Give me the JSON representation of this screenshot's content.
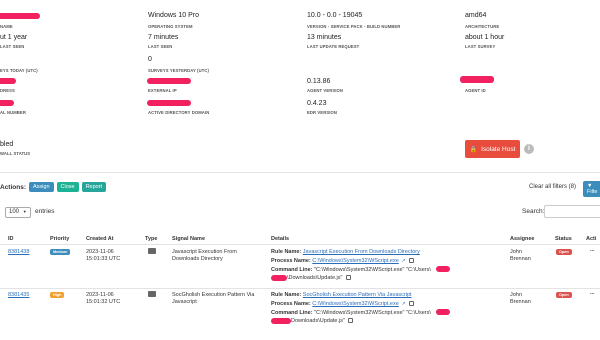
{
  "summary": {
    "row1": [
      {
        "label": "NAME",
        "value": ""
      },
      {
        "label": "OPERATING SYSTEM",
        "value": "Windows 10 Pro"
      },
      {
        "label": "VERSION - SERVICE PACK - BUILD NUMBER",
        "value": "10.0 - 0.0 - 19045"
      },
      {
        "label": "ARCHITECTURE",
        "value": "amd64"
      }
    ],
    "row2": [
      {
        "label": "LAST SEEN",
        "value": "ut 1 year"
      },
      {
        "label": "LAST SEEN",
        "value": "7 minutes"
      },
      {
        "label": "LAST UPDATE REQUEST",
        "value": "13 minutes"
      },
      {
        "label": "LAST SURVEY",
        "value": "about 1 hour"
      }
    ],
    "row3": [
      {
        "label": "EYS TODAY (UTC)",
        "value": ""
      },
      {
        "label": "SURVEYS YESTERDAY (UTC)",
        "value": "0"
      }
    ],
    "row4": [
      {
        "label": "DRESS",
        "value": ""
      },
      {
        "label": "EXTERNAL IP",
        "value": ""
      },
      {
        "label": "AGENT VERSION",
        "value": "0.13.86"
      },
      {
        "label": "AGENT ID",
        "value": ""
      }
    ],
    "row5": [
      {
        "label": "AL NUMBER",
        "value": ""
      },
      {
        "label": "ACTIVE DIRECTORY DOMAIN",
        "value": ""
      },
      {
        "label": "EDR VERSION",
        "value": "0.4.23"
      }
    ],
    "status": {
      "value": "bled",
      "label": "WALL STATUS"
    },
    "isolate_label": "Isolate Host",
    "info_glyph": "i"
  },
  "actions": {
    "label": "Actions:",
    "assign": "Assign",
    "close": "Close",
    "report": "Report",
    "clear_filters": "Clear all filters (8)",
    "filter": "Filte"
  },
  "table_controls": {
    "page_size": "100",
    "entries_label": "entries",
    "search_label": "Search:"
  },
  "table": {
    "headers": [
      "ID",
      "Priority",
      "Created At",
      "Type",
      "Signal Name",
      "Details",
      "Assignee",
      "Status",
      "Acti"
    ],
    "rows": [
      {
        "id": "8381438",
        "priority": "Medium",
        "created_date": "2023-11-06",
        "created_time": "15:01:33 UTC",
        "signal_line1": "Javascript Execution From",
        "signal_line2": "Downloads Directory",
        "rule_label": "Rule Name:",
        "rule_value": "Javascript Execution From Downloads Directory",
        "process_label": "Process Name:",
        "process_value": "C:\\Windows\\System32\\WScript.exe",
        "cmd_label": "Command Line:",
        "cmd_value_1": "\"C:\\Windows\\System32\\WScript.exe\" \"C:\\Users\\",
        "cmd_value_2": "\\Downloads\\Update.js\"",
        "assignee_1": "John",
        "assignee_2": "Brennan",
        "status": "Open",
        "action": "..."
      },
      {
        "id": "8381435",
        "priority": "High",
        "created_date": "2023-11-06",
        "created_time": "15:01:32 UTC",
        "signal_line1": "SocGholish Execution Pattern Via",
        "signal_line2": "Javascript",
        "rule_label": "Rule Name:",
        "rule_value": "SocGholish Execution Pattern Via Javascript",
        "process_label": "Process Name:",
        "process_value": "C:\\Windows\\System32\\WScript.exe",
        "cmd_label": "Command Line:",
        "cmd_value_1": "\"C:\\Windows\\System32\\WScript.exe\" \"C:\\Users\\",
        "cmd_value_2": "Downloads\\Update.js\"",
        "assignee_1": "John",
        "assignee_2": "Brennan",
        "status": "Open",
        "action": "..."
      }
    ]
  }
}
